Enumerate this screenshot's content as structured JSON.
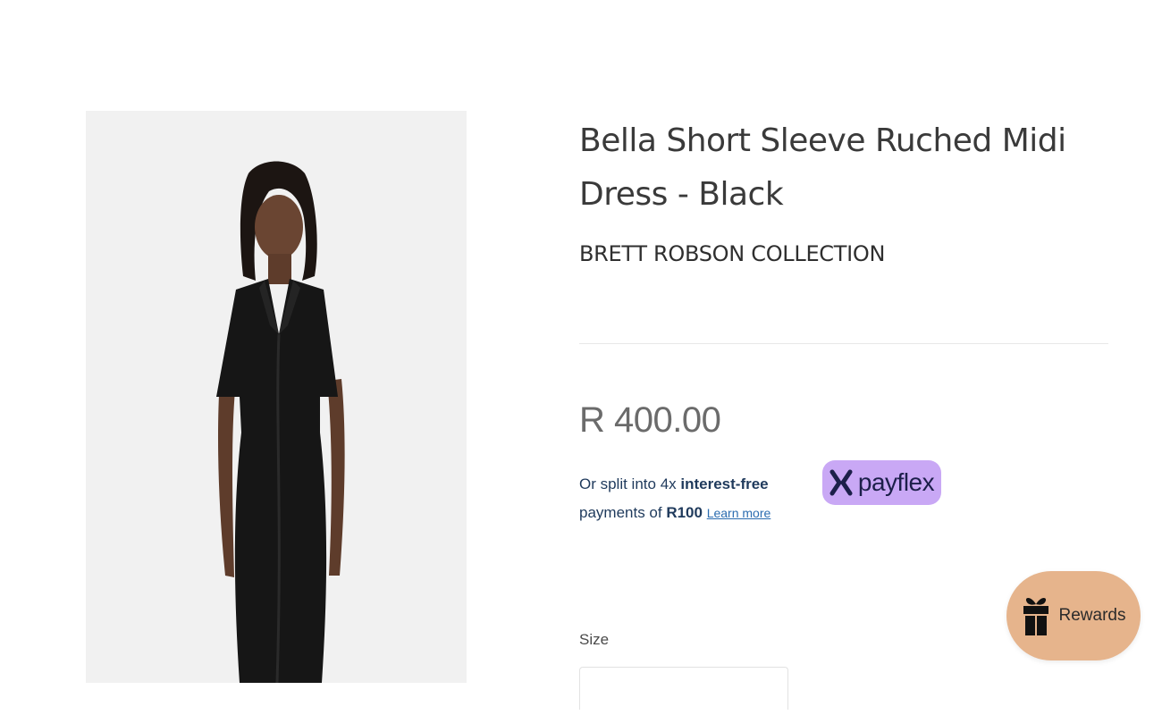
{
  "product": {
    "title": "Bella Short Sleeve Ruched Midi Dress - Black",
    "vendor": "BRETT ROBSON COLLECTION",
    "price": "R 400.00",
    "image_icon": "product-photo"
  },
  "payflex": {
    "line1_prefix": "Or split into 4x ",
    "line1_bold": "interest-free",
    "line2_prefix": "payments of ",
    "line2_bold": "R100",
    "learn_more": "Learn more",
    "badge_label": "payflex",
    "badge_icon": "payflex-x-logo",
    "badge_color": "#c9a8f5"
  },
  "size": {
    "label": "Size",
    "selected": ""
  },
  "rewards": {
    "label": "Rewards",
    "icon": "gift-icon",
    "color": "#e6b48c"
  }
}
